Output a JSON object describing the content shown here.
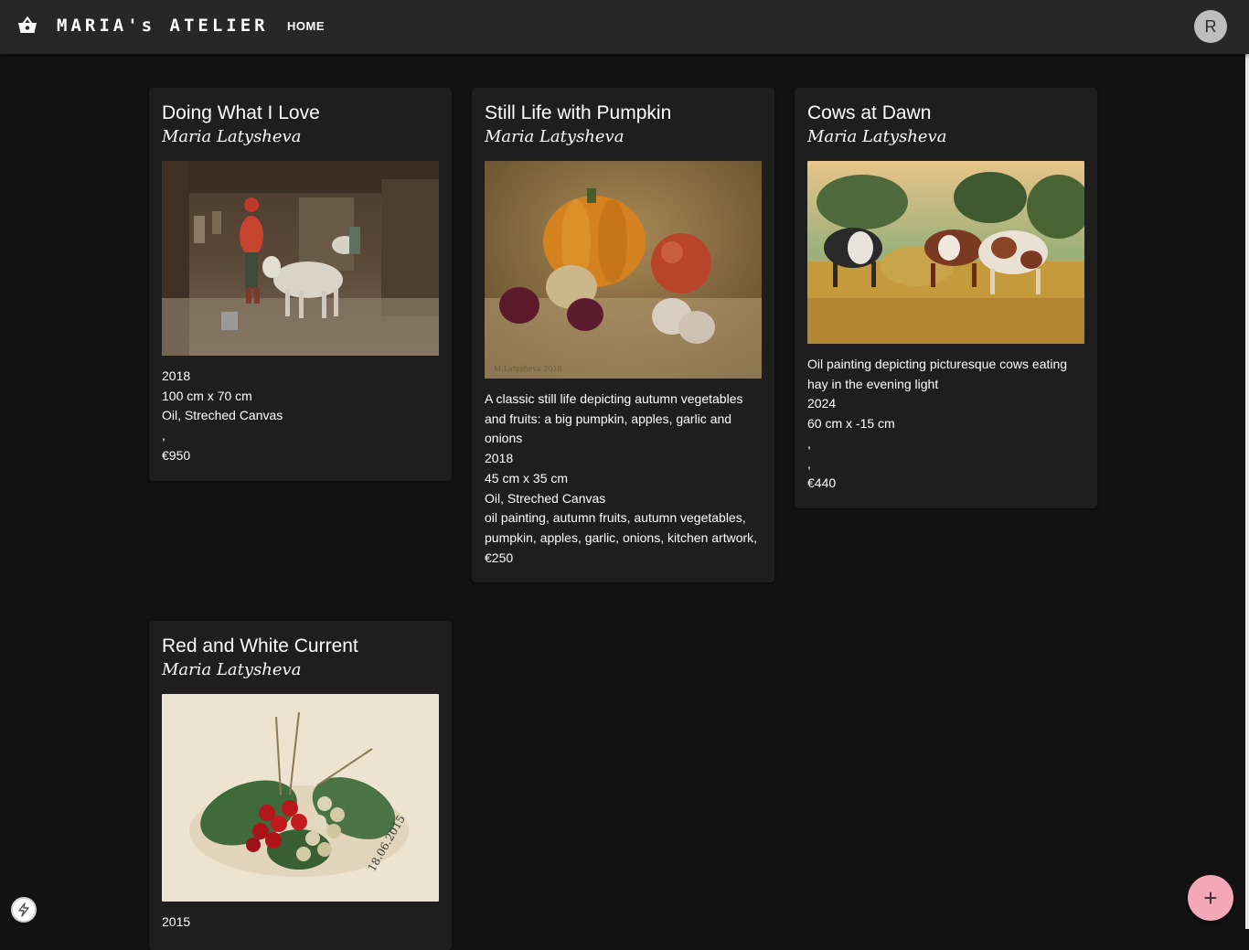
{
  "appbar": {
    "brand": "MARIA's ATELIER",
    "home_label": "HOME",
    "avatar_initial": "R",
    "cart_icon": "shopping-basket-icon"
  },
  "artworks": [
    {
      "title": "Doing What I Love",
      "artist": "Maria Latysheva",
      "lines": [
        "2018",
        "100 cm x 70 cm",
        "Oil, Streched Canvas",
        ",",
        "€950"
      ]
    },
    {
      "title": "Still Life with Pumpkin",
      "artist": "Maria Latysheva",
      "lines": [
        "A classic still life depicting autumn vegetables and fruits: a big pumpkin, apples, garlic and onions",
        "2018",
        "45 cm x 35 cm",
        "Oil, Streched Canvas",
        "oil painting, autumn fruits, autumn vegetables, pumpkin, apples, garlic, onions, kitchen artwork,",
        "€250"
      ]
    },
    {
      "title": "Cows at Dawn",
      "artist": "Maria Latysheva",
      "lines": [
        "Oil painting depicting picturesque cows eating hay in the evening light",
        "2024",
        "60 cm x -15 cm",
        ",",
        ",",
        "€440"
      ]
    },
    {
      "title": "Red and White Current",
      "artist": "Maria Latysheva",
      "lines": [
        "2015"
      ]
    }
  ],
  "fab": {
    "label": "+",
    "icon": "plus-icon"
  },
  "corner_badge": {
    "icon": "lightning-bolt-icon"
  },
  "colors": {
    "background": "#121212",
    "appbar": "#272727",
    "card": "#1e1e1e",
    "fab": "#f4a7b6",
    "avatar": "#bdbdbd"
  }
}
